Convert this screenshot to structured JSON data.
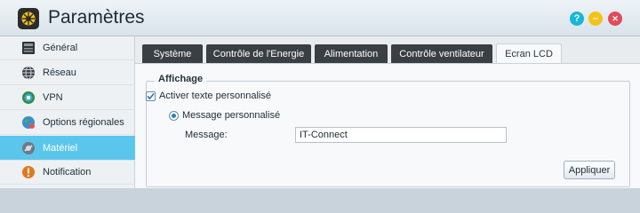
{
  "window": {
    "title": "Paramètres",
    "icon": "gear-wheel-icon",
    "controls": [
      {
        "name": "help",
        "glyph": "?"
      },
      {
        "name": "minimize",
        "glyph": "–"
      },
      {
        "name": "close",
        "glyph": "✕"
      }
    ]
  },
  "sidebar": {
    "items": [
      {
        "label": "Général",
        "icon": "general-icon",
        "active": false
      },
      {
        "label": "Réseau",
        "icon": "network-icon",
        "active": false
      },
      {
        "label": "VPN",
        "icon": "vpn-icon",
        "active": false
      },
      {
        "label": "Options régionales",
        "icon": "globe-icon",
        "active": false
      },
      {
        "label": "Matériel",
        "icon": "hardware-icon",
        "active": true
      },
      {
        "label": "Notification",
        "icon": "notification-icon",
        "active": false
      }
    ]
  },
  "tabs": [
    {
      "label": "Système",
      "active": false
    },
    {
      "label": "Contrôle de l'Energie",
      "active": false
    },
    {
      "label": "Alimentation",
      "active": false
    },
    {
      "label": "Contrôle ventilateur",
      "active": false
    },
    {
      "label": "Ecran LCD",
      "active": true
    }
  ],
  "section": {
    "legend": "Affichage",
    "checkbox_label": "Activer texte personnalisé",
    "checkbox_checked": true,
    "radio_label": "Message personnalisé",
    "radio_selected": true,
    "message_label": "Message:",
    "message_value": "IT-Connect"
  },
  "actions": {
    "apply_label": "Appliquer"
  },
  "colors": {
    "active_sidebar": "#5bc6ec",
    "tab_dark": "#3a3f44",
    "help": "#18b7d6",
    "minimize": "#f3c317",
    "close": "#e24a5a"
  }
}
